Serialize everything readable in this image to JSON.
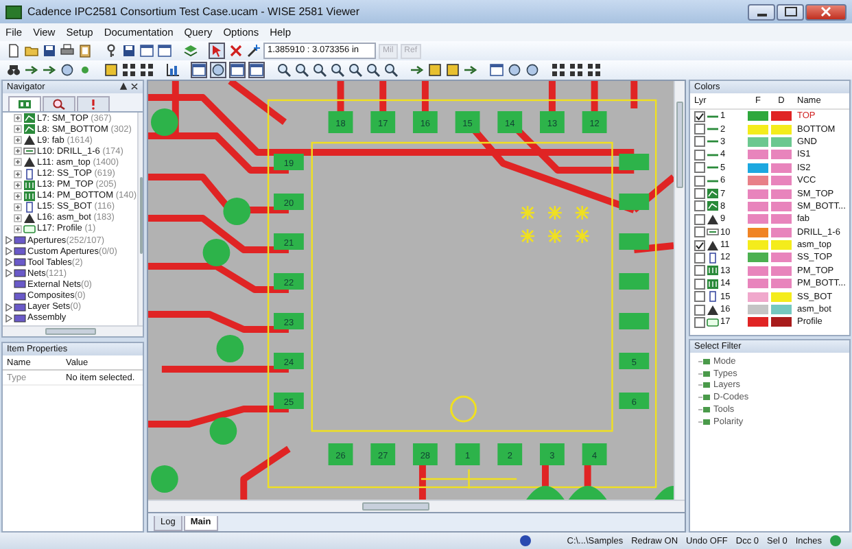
{
  "window": {
    "title": "Cadence IPC2581 Consortium Test Case.ucam - WISE 2581 Viewer"
  },
  "menu": [
    "File",
    "View",
    "Setup",
    "Documentation",
    "Query",
    "Options",
    "Help"
  ],
  "toolbar": {
    "coordinates": "1.385910 : 3.073356 in",
    "unit_buttons": [
      {
        "label": "Mil",
        "disabled": true
      },
      {
        "label": "Ref",
        "disabled": true
      }
    ]
  },
  "navigator": {
    "title": "Navigator",
    "tabs": [
      {
        "selected": true
      },
      {
        "selected": false
      },
      {
        "selected": false
      }
    ],
    "layer_items": [
      {
        "kind": "mask",
        "label": "L7: SM_TOP",
        "count": "(367)",
        "expanded": false
      },
      {
        "kind": "mask",
        "label": "L8: SM_BOTTOM",
        "count": "(302)",
        "expanded": false
      },
      {
        "kind": "triangle",
        "label": "L9: fab",
        "count": "(1614)",
        "expanded": false
      },
      {
        "kind": "drill",
        "label": "L10: DRILL_1-6",
        "count": "(174)",
        "expanded": false
      },
      {
        "kind": "triangle",
        "label": "L11: asm_top",
        "count": "(1400)",
        "expanded": false
      },
      {
        "kind": "outline",
        "label": "L12: SS_TOP",
        "count": "(619)",
        "expanded": false
      },
      {
        "kind": "paste",
        "label": "L13: PM_TOP",
        "count": "(205)",
        "expanded": false
      },
      {
        "kind": "paste",
        "label": "L14: PM_BOTTOM",
        "count": "(140)",
        "expanded": false
      },
      {
        "kind": "outline",
        "label": "L15: SS_BOT",
        "count": "(116)",
        "expanded": false
      },
      {
        "kind": "triangle",
        "label": "L16: asm_bot",
        "count": "(183)",
        "expanded": false
      },
      {
        "kind": "profile",
        "label": "L17: Profile",
        "count": "(1)",
        "expanded": false
      }
    ],
    "items": [
      {
        "label": "Apertures",
        "count": "(252/107)",
        "expanded": false
      },
      {
        "label": "Custom Apertures",
        "count": "(0/0)",
        "expanded": false
      },
      {
        "label": "Tool Tables",
        "count": "(2)",
        "expanded": false
      },
      {
        "label": "Nets",
        "count": "(121)",
        "expanded": false
      },
      {
        "label": "External Nets",
        "count": "(0)"
      },
      {
        "label": "Composites",
        "count": "(0)"
      },
      {
        "label": "Layer Sets",
        "count": "(0)",
        "expanded": false
      },
      {
        "label": "Assembly",
        "expanded": false
      }
    ]
  },
  "item_properties": {
    "title": "Item Properties",
    "columns": [
      "Name",
      "Value"
    ],
    "rows": [
      {
        "name": "Type",
        "value": "No item selected."
      }
    ]
  },
  "canvas": {
    "top_row": [
      "18",
      "17",
      "16",
      "15",
      "14",
      "13",
      "12"
    ],
    "left_column": [
      "19",
      "20",
      "21",
      "22",
      "23",
      "24",
      "25"
    ],
    "bottom_row": [
      "26",
      "27",
      "28",
      "1",
      "2",
      "3",
      "4"
    ],
    "right_column": [
      "5",
      "6"
    ]
  },
  "bottom_tabs": [
    {
      "label": "Log",
      "selected": false
    },
    {
      "label": "Main",
      "selected": true
    }
  ],
  "colors": {
    "title": "Colors",
    "columns": [
      "Lyr",
      "F",
      "D",
      "Name"
    ],
    "rows": [
      {
        "checked": true,
        "kind": "line",
        "number": "1",
        "f": {
          "color": "#2ea83c"
        },
        "d": {
          "color": "#e02424"
        },
        "name": "TOP",
        "active": true
      },
      {
        "checked": false,
        "kind": "line",
        "number": "2",
        "f": {
          "color": "#f4ec1c"
        },
        "d": {
          "color": "#f4ec1c"
        },
        "name": "BOTTOM",
        "active": false
      },
      {
        "checked": false,
        "kind": "line",
        "number": "3",
        "f": {
          "color": "#6cc890"
        },
        "d": {
          "color": "#6cc890"
        },
        "name": "GND",
        "active": false
      },
      {
        "checked": false,
        "kind": "line",
        "number": "4",
        "f": {
          "color": "#e884bc"
        },
        "d": {
          "color": "#e884bc"
        },
        "name": "IS1",
        "active": false
      },
      {
        "checked": false,
        "kind": "line",
        "number": "5",
        "f": {
          "color": "#1ca8e0"
        },
        "d": {
          "color": "#e884bc"
        },
        "name": "IS2",
        "active": false
      },
      {
        "checked": false,
        "kind": "line",
        "number": "6",
        "f": {
          "color": "#e88088"
        },
        "d": {
          "color": "#e884bc"
        },
        "name": "VCC",
        "active": false
      },
      {
        "checked": false,
        "kind": "mask",
        "number": "7",
        "f": {
          "color": "#e884bc"
        },
        "d": {
          "color": "#e884bc"
        },
        "name": "SM_TOP",
        "active": false
      },
      {
        "checked": false,
        "kind": "mask",
        "number": "8",
        "f": {
          "color": "#e884bc"
        },
        "d": {
          "color": "#e884bc"
        },
        "name": "SM_BOTT...",
        "active": false
      },
      {
        "checked": false,
        "kind": "triangle",
        "number": "9",
        "f": {
          "color": "#e884bc"
        },
        "d": {
          "color": "#e884bc"
        },
        "name": "fab",
        "active": false
      },
      {
        "checked": false,
        "kind": "drill",
        "number": "10",
        "f": {
          "color": "#f08424"
        },
        "d": {
          "color": "#e884bc"
        },
        "name": "DRILL_1-6",
        "active": false
      },
      {
        "checked": true,
        "kind": "triangle",
        "number": "11",
        "f": {
          "color": "#f4ec1c"
        },
        "d": {
          "color": "#f4ec1c"
        },
        "name": "asm_top",
        "active": false
      },
      {
        "checked": false,
        "kind": "outline",
        "number": "12",
        "f": {
          "color": "#4cb050"
        },
        "d": {
          "color": "#e884bc"
        },
        "name": "SS_TOP",
        "active": false
      },
      {
        "checked": false,
        "kind": "paste",
        "number": "13",
        "f": {
          "color": "#e884bc"
        },
        "d": {
          "color": "#e884bc"
        },
        "name": "PM_TOP",
        "active": false
      },
      {
        "checked": false,
        "kind": "paste",
        "number": "14",
        "f": {
          "color": "#e884bc"
        },
        "d": {
          "color": "#e884bc"
        },
        "name": "PM_BOTT...",
        "active": false
      },
      {
        "checked": false,
        "kind": "outline",
        "number": "15",
        "f": {
          "color": "#f0a8cc"
        },
        "d": {
          "color": "#f4ec1c"
        },
        "name": "SS_BOT",
        "active": false
      },
      {
        "checked": false,
        "kind": "triangle",
        "number": "16",
        "f": {
          "color": "#c4c4c4"
        },
        "d": {
          "color": "#74c8c0"
        },
        "name": "asm_bot",
        "active": false
      },
      {
        "checked": false,
        "kind": "profile",
        "number": "17",
        "f": {
          "color": "#e02424"
        },
        "d": {
          "color": "#a81c1c"
        },
        "name": "Profile",
        "active": false
      }
    ]
  },
  "select_filter": {
    "title": "Select Filter",
    "items": [
      "Mode",
      "Types",
      "Layers",
      "D-Codes",
      "Tools",
      "Polarity"
    ]
  },
  "status_bar": [
    "C:\\...\\Samples",
    "Redraw ON",
    "Undo OFF",
    "Dcc 0",
    "Sel 0",
    "Inches"
  ]
}
